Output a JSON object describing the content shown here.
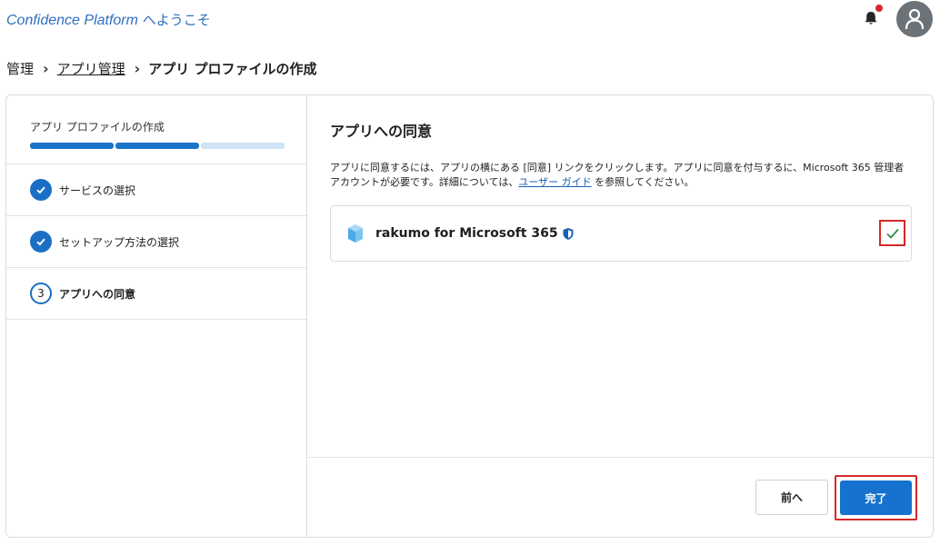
{
  "header": {
    "brand_name": "Confidence Platform",
    "brand_suffix": " へようこそ",
    "notification_badge_color": "#d6262b",
    "icons": [
      "bell-icon",
      "user-avatar-icon"
    ]
  },
  "breadcrumb": {
    "items": [
      "管理",
      "アプリ管理",
      "アプリ プロファイルの作成"
    ]
  },
  "sidebar": {
    "title": "アプリ プロファイルの作成",
    "progress": {
      "completed_steps": 2,
      "total_steps": 3
    },
    "steps": [
      {
        "number": "1",
        "label": "サービスの選択",
        "status": "done"
      },
      {
        "number": "2",
        "label": "セットアップ方法の選択",
        "status": "done"
      },
      {
        "number": "3",
        "label": "アプリへの同意",
        "status": "current"
      }
    ]
  },
  "main": {
    "title": "アプリへの同意",
    "description_before_link": "アプリに同意するには、アプリの横にある [同意] リンクをクリックします。アプリに同意を付与するに、Microsoft 365 管理者アカウントが必要です。詳細については、",
    "description_link": "ユーザー ガイド",
    "description_after_link": " を参照してください。",
    "app": {
      "name": "rakumo for Microsoft 365",
      "consent_status": "consented",
      "icons": [
        "rakumo-app-icon",
        "verified-shield-icon",
        "checkmark-icon"
      ]
    }
  },
  "footer": {
    "back_label": "前へ",
    "finish_label": "完了"
  },
  "colors": {
    "accent": "#1572cf",
    "highlight_border": "#d62828",
    "brand_text": "#2f6fbf",
    "progress_done": "#1a73c9",
    "progress_todo": "#cfe3f6"
  }
}
